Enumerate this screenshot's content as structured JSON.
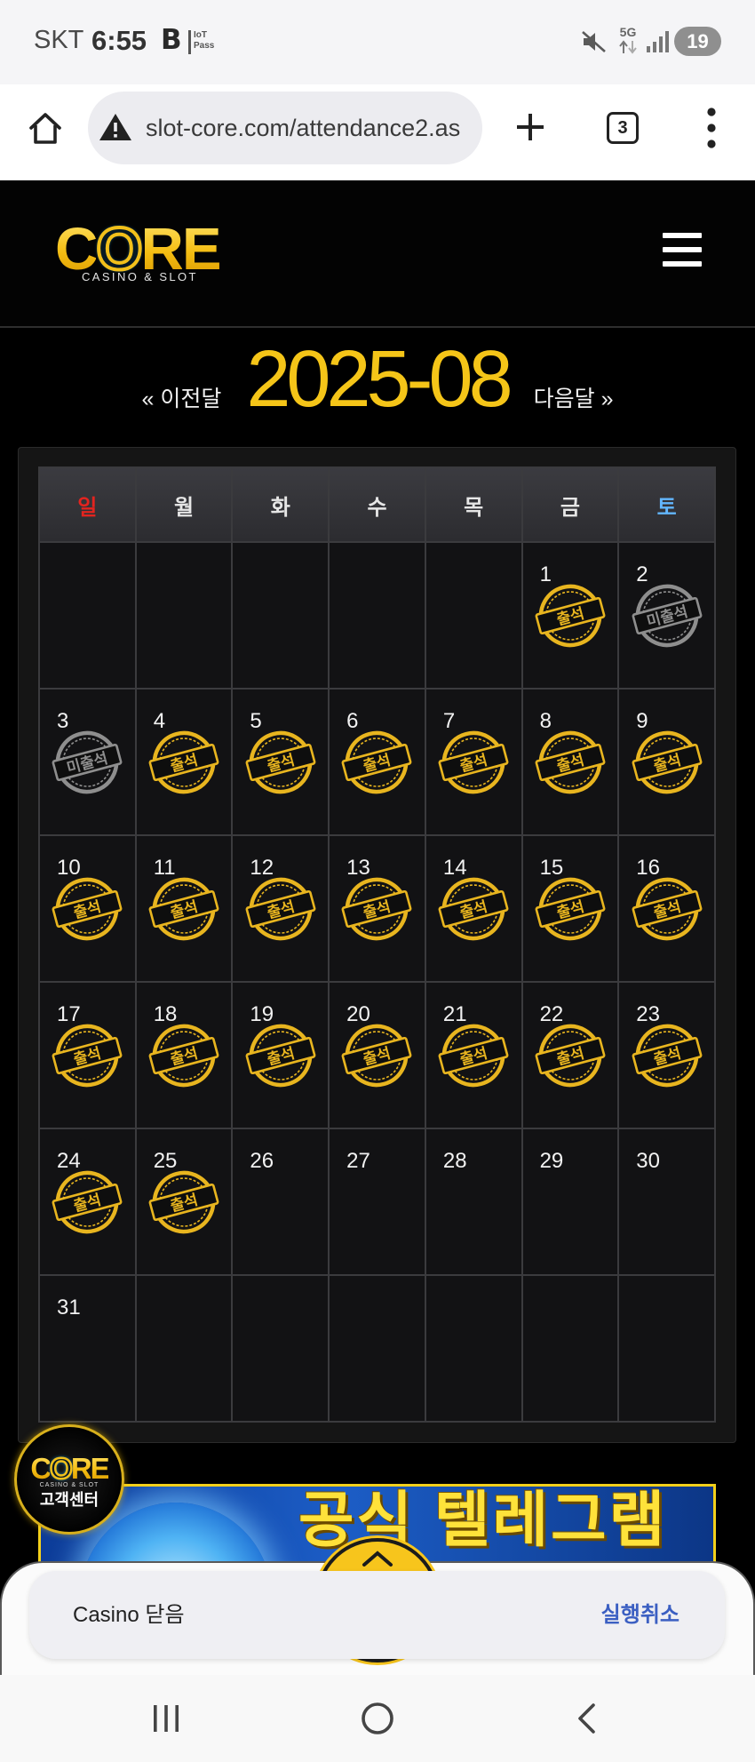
{
  "status_bar": {
    "carrier": "SKT",
    "time": "6:55",
    "app_badge": "B",
    "iot_top": "IoT",
    "iot_bottom": "Pass",
    "network": "5G",
    "battery_level": "19"
  },
  "browser": {
    "url": "slot-core.com/attendance2.as",
    "tab_count": "3"
  },
  "site_header": {
    "logo_text": "CORE",
    "logo_subtitle": "CASINO & SLOT"
  },
  "month_nav": {
    "prev_label": "« 이전달",
    "current_month": "2025-08",
    "next_label": "다음달 »"
  },
  "calendar": {
    "weekdays": [
      "일",
      "월",
      "화",
      "수",
      "목",
      "금",
      "토"
    ],
    "stamp_colors": {
      "출석": "#e8b51f",
      "미출석": "#8e8e8e"
    },
    "weeks": [
      [
        null,
        null,
        null,
        null,
        null,
        {
          "day": 1,
          "stamp": "출석"
        },
        {
          "day": 2,
          "stamp": "미출석"
        }
      ],
      [
        {
          "day": 3,
          "stamp": "미출석"
        },
        {
          "day": 4,
          "stamp": "출석"
        },
        {
          "day": 5,
          "stamp": "출석"
        },
        {
          "day": 6,
          "stamp": "출석"
        },
        {
          "day": 7,
          "stamp": "출석"
        },
        {
          "day": 8,
          "stamp": "출석"
        },
        {
          "day": 9,
          "stamp": "출석"
        }
      ],
      [
        {
          "day": 10,
          "stamp": "출석"
        },
        {
          "day": 11,
          "stamp": "출석"
        },
        {
          "day": 12,
          "stamp": "출석"
        },
        {
          "day": 13,
          "stamp": "출석"
        },
        {
          "day": 14,
          "stamp": "출석"
        },
        {
          "day": 15,
          "stamp": "출석"
        },
        {
          "day": 16,
          "stamp": "출석"
        }
      ],
      [
        {
          "day": 17,
          "stamp": "출석"
        },
        {
          "day": 18,
          "stamp": "출석"
        },
        {
          "day": 19,
          "stamp": "출석"
        },
        {
          "day": 20,
          "stamp": "출석"
        },
        {
          "day": 21,
          "stamp": "출석"
        },
        {
          "day": 22,
          "stamp": "출석"
        },
        {
          "day": 23,
          "stamp": "출석"
        }
      ],
      [
        {
          "day": 24,
          "stamp": "출석"
        },
        {
          "day": 25,
          "stamp": "출석"
        },
        {
          "day": 26
        },
        {
          "day": 27
        },
        {
          "day": 28
        },
        {
          "day": 29
        },
        {
          "day": 30
        }
      ],
      [
        {
          "day": 31
        },
        null,
        null,
        null,
        null,
        null,
        null
      ]
    ]
  },
  "support_badge": {
    "logo_text": "CORE",
    "logo_subtitle": "CASINO & SLOT",
    "label": "고객센터"
  },
  "banner": {
    "title": "공식 텔레그램"
  },
  "toast": {
    "message": "Casino 닫음",
    "action": "실행취소"
  },
  "colors": {
    "gold": "#f5c518",
    "sunday": "#e3241f",
    "saturday": "#63b7ff",
    "toast_action": "#3b5fc2"
  }
}
